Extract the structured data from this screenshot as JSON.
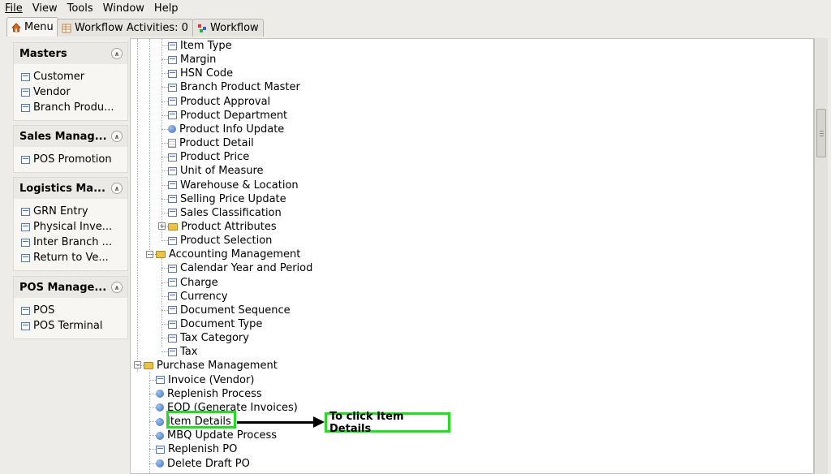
{
  "menubar": {
    "items": [
      "File",
      "View",
      "Tools",
      "Window",
      "Help"
    ]
  },
  "tabs": [
    {
      "label": "Menu",
      "icon": "home-icon",
      "active": true
    },
    {
      "label": "Workflow Activities: 0",
      "icon": "table-icon",
      "active": false
    },
    {
      "label": "Workflow",
      "icon": "workflow-icon",
      "active": false
    }
  ],
  "sidebar": {
    "groups": [
      {
        "title": "Masters",
        "items": [
          "Customer",
          "Vendor",
          "Branch Produ..."
        ]
      },
      {
        "title": "Sales Manag...",
        "items": [
          "POS Promotion"
        ]
      },
      {
        "title": "Logistics Ma...",
        "items": [
          "GRN Entry",
          "Physical Inve...",
          "Inter Branch ...",
          "Return to Ve..."
        ]
      },
      {
        "title": "POS Manage...",
        "items": [
          "POS",
          "POS Terminal"
        ]
      }
    ]
  },
  "tree": {
    "rows": [
      {
        "label": "Item Type",
        "icon": "window-icon"
      },
      {
        "label": "Margin",
        "icon": "window-icon"
      },
      {
        "label": "HSN Code",
        "icon": "window-icon"
      },
      {
        "label": "Branch Product Master",
        "icon": "window-icon"
      },
      {
        "label": "Product Approval",
        "icon": "window-icon"
      },
      {
        "label": "Product Department",
        "icon": "window-icon"
      },
      {
        "label": "Product Info Update",
        "icon": "process-icon"
      },
      {
        "label": "Product Detail",
        "icon": "report-icon"
      },
      {
        "label": "Product Price",
        "icon": "window-icon"
      },
      {
        "label": "Unit of Measure",
        "icon": "window-icon"
      },
      {
        "label": "Warehouse & Location",
        "icon": "window-icon"
      },
      {
        "label": "Selling Price Update",
        "icon": "window-icon"
      },
      {
        "label": "Sales Classification",
        "icon": "window-icon"
      },
      {
        "label": "Product Attributes",
        "icon": "folder-icon"
      },
      {
        "label": "Product Selection",
        "icon": "window-icon"
      },
      {
        "label": "Accounting Management",
        "icon": "folder-open-icon"
      },
      {
        "label": "Calendar Year and Period",
        "icon": "window-icon"
      },
      {
        "label": "Charge",
        "icon": "window-icon"
      },
      {
        "label": "Currency",
        "icon": "window-icon"
      },
      {
        "label": "Document Sequence",
        "icon": "window-icon"
      },
      {
        "label": "Document Type",
        "icon": "window-icon"
      },
      {
        "label": "Tax Category",
        "icon": "window-icon"
      },
      {
        "label": "Tax",
        "icon": "window-icon"
      },
      {
        "label": "Purchase Management",
        "icon": "folder-open-icon"
      },
      {
        "label": "Invoice (Vendor)",
        "icon": "window-icon"
      },
      {
        "label": "Replenish Process",
        "icon": "process-icon"
      },
      {
        "label": "EOD (Generate Invoices)",
        "icon": "process-icon"
      },
      {
        "label": "Item Details",
        "icon": "process-icon"
      },
      {
        "label": "MBQ Update Process",
        "icon": "process-icon"
      },
      {
        "label": "Replenish PO",
        "icon": "window-icon"
      },
      {
        "label": "Delete Draft PO",
        "icon": "process-icon"
      }
    ]
  },
  "annotation": {
    "callout_text": "To click Item Details",
    "highlight_color": "#22dd22"
  }
}
